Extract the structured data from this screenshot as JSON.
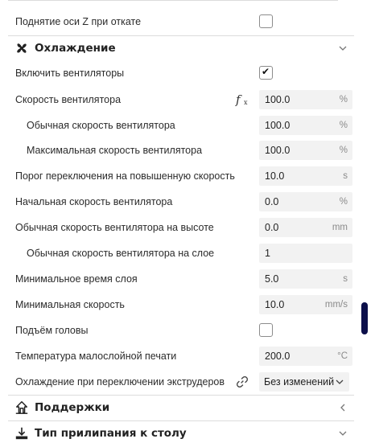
{
  "rows_top": {
    "retract_lift_z": {
      "label": "Поднятие оси Z при откате",
      "checked": false
    }
  },
  "cooling": {
    "title": "Охлаждение",
    "icon": "fan-icon",
    "enable_fans": {
      "label": "Включить вентиляторы",
      "checked": true
    },
    "fan_speed": {
      "label": "Скорость вентилятора",
      "value": "100.0",
      "unit": "%",
      "icon": "function-icon"
    },
    "normal_fan_speed": {
      "label": "Обычная скорость вентилятора",
      "value": "100.0",
      "unit": "%"
    },
    "max_fan_speed": {
      "label": "Максимальная скорость вентилятора",
      "value": "100.0",
      "unit": "%"
    },
    "threshold_high_speed": {
      "label": "Порог переключения на повышенную скорость",
      "value": "10.0",
      "unit": "s"
    },
    "initial_fan_speed": {
      "label": "Начальная скорость вентилятора",
      "value": "0.0",
      "unit": "%"
    },
    "normal_speed_at_height": {
      "label": "Обычная скорость вентилятора на высоте",
      "value": "0.0",
      "unit": "mm"
    },
    "normal_speed_at_layer": {
      "label": "Обычная скорость вентилятора на слое",
      "value": "1",
      "unit": ""
    },
    "min_layer_time": {
      "label": "Минимальное время слоя",
      "value": "5.0",
      "unit": "s"
    },
    "min_speed": {
      "label": "Минимальная скорость",
      "value": "10.0",
      "unit": "mm/s"
    },
    "lift_head": {
      "label": "Подъём головы",
      "checked": false
    },
    "low_layer_temp": {
      "label": "Температура малослойной печати",
      "value": "200.0",
      "unit": "°C"
    },
    "extruder_switch_cooling": {
      "label": "Охлаждение при переключении экструдеров",
      "value": "Без изменений",
      "icon": "link-icon"
    }
  },
  "sections": {
    "supports": {
      "title": "Поддержки",
      "icon": "support-icon"
    },
    "bed_adhesion": {
      "title": "Тип прилипания к столу",
      "icon": "bed-adhesion-icon"
    }
  },
  "colors": {
    "field_bg": "#f2f2f2",
    "scrollbar": "#0c0f4a"
  }
}
